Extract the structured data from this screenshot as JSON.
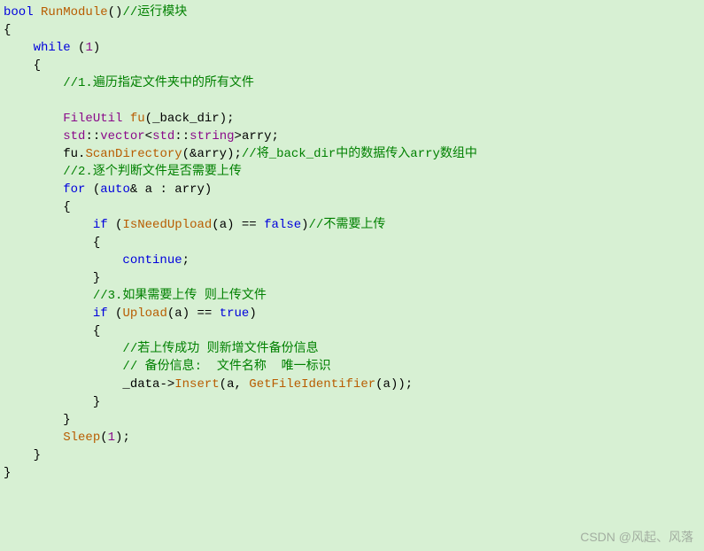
{
  "code": {
    "l0_kw1": "bool",
    "l0_fn": "RunModule",
    "l0_c": "//运行模块",
    "l1": "{",
    "l2_kw": "while",
    "l2_num": "1",
    "l3": "{",
    "l4_c": "//1.遍历指定文件夹中的所有文件",
    "l5_type": "FileUtil",
    "l5_fn": "fu",
    "l5_arg": "_back_dir",
    "l6_ns": "std",
    "l6_vec": "vector",
    "l6_str": "string",
    "l6_var": "arry",
    "l7_obj": "fu",
    "l7_fn": "ScanDirectory",
    "l7_arg": "arry",
    "l7_c": "//将_back_dir中的数据传入arry数组中",
    "l8_c": "//2.逐个判断文件是否需要上传",
    "l9_kw": "for",
    "l9_auto": "auto",
    "l9_a": "a",
    "l9_arr": "arry",
    "l10": "{",
    "l11_kw": "if",
    "l11_fn": "IsNeedUpload",
    "l11_arg": "a",
    "l11_false": "false",
    "l11_c": "//不需要上传",
    "l12": "{",
    "l13_kw": "continue",
    "l14": "}",
    "l15_c": "//3.如果需要上传 则上传文件",
    "l16_kw": "if",
    "l16_fn": "Upload",
    "l16_arg": "a",
    "l16_true": "true",
    "l17": "{",
    "l18_c": "//若上传成功 则新增文件备份信息",
    "l19_c": "// 备份信息:  文件名称  唯一标识",
    "l20_obj": "_data",
    "l20_fn": "Insert",
    "l20_a1": "a",
    "l20_fn2": "GetFileIdentifier",
    "l20_a2": "a",
    "l21": "}",
    "l22": "}",
    "l23_fn": "Sleep",
    "l23_num": "1",
    "l24": "}",
    "l25": "}"
  },
  "watermark": "CSDN @风起、风落"
}
